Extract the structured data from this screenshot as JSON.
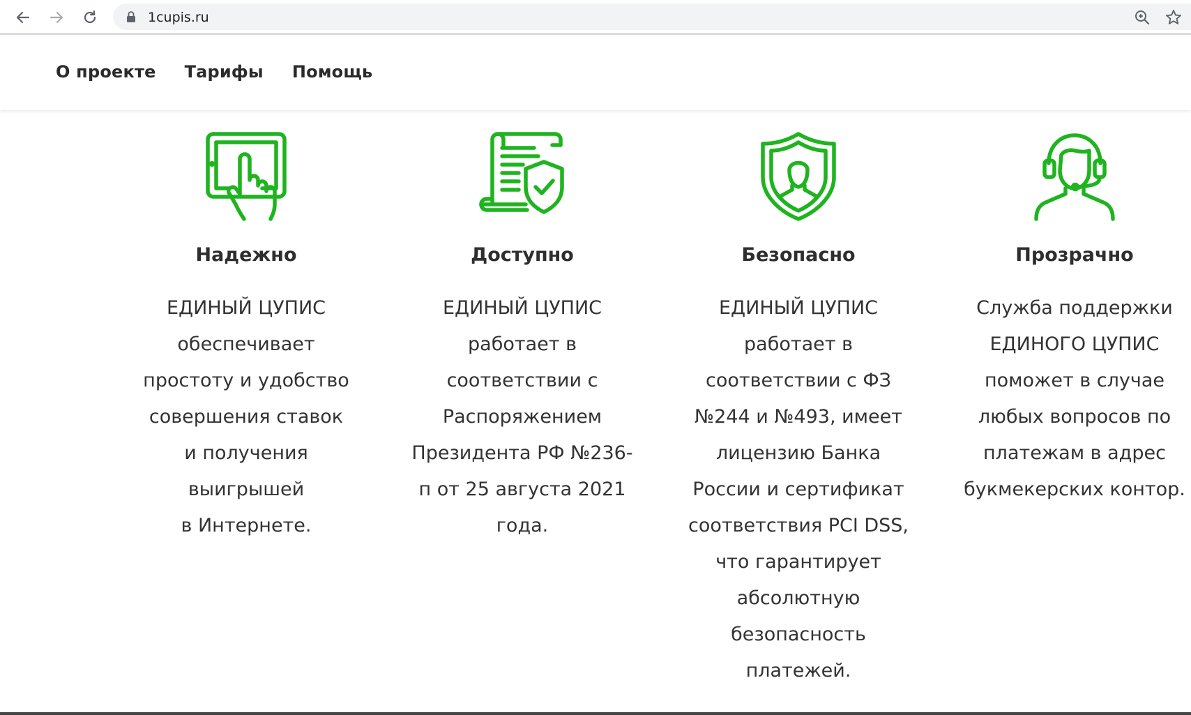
{
  "browser": {
    "url": "1cupis.ru"
  },
  "nav": {
    "items": [
      {
        "label": "О проекте"
      },
      {
        "label": "Тарифы"
      },
      {
        "label": "Помощь"
      }
    ]
  },
  "features": [
    {
      "icon": "tablet-touch-icon",
      "title": "Надежно",
      "lines": [
        "ЕДИНЫЙ ЦУПИС",
        "обеспечивает",
        "простоту и удобство",
        "совершения ставок",
        "и получения",
        "выигрышей",
        "в Интернете."
      ]
    },
    {
      "icon": "document-shield-icon",
      "title": "Доступно",
      "lines": [
        "ЕДИНЫЙ ЦУПИС",
        "работает в",
        "соответствии с",
        "Распоряжением",
        "Президента РФ №236-",
        "п от 25 августа 2021",
        "года."
      ]
    },
    {
      "icon": "shield-person-icon",
      "title": "Безопасно",
      "lines": [
        "ЕДИНЫЙ ЦУПИС",
        "работает в",
        "соответствии с ФЗ",
        "№244 и №493, имеет",
        "лицензию Банка",
        "России и сертификат",
        "соответствия PCI DSS,",
        "что гарантирует",
        "абсолютную",
        "безопасность",
        "платежей."
      ]
    },
    {
      "icon": "support-headset-icon",
      "title": "Прозрачно",
      "lines": [
        "Служба поддержки",
        "ЕДИНОГО ЦУПИС",
        "поможет в случае",
        "любых вопросов по",
        "платежам в адрес",
        "букмекерских контор."
      ]
    }
  ],
  "colors": {
    "accent": "#1fb41f",
    "text": "#333333",
    "heading": "#2e2e2e"
  }
}
